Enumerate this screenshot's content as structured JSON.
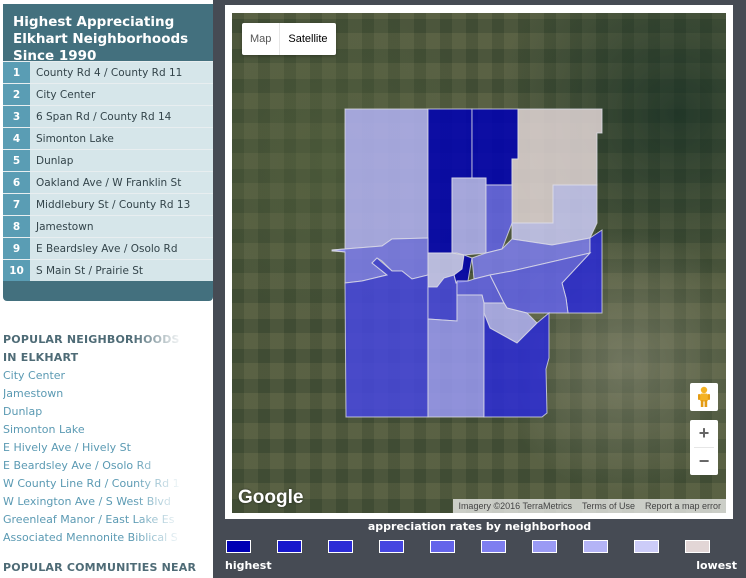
{
  "sidebar": {
    "top_list": {
      "title": "Highest Appreciating Elkhart Neighborhoods Since 1990",
      "items": [
        {
          "rank": "1",
          "name": "County Rd 4 / County Rd 11"
        },
        {
          "rank": "2",
          "name": "City Center"
        },
        {
          "rank": "3",
          "name": "6 Span Rd / County Rd 14"
        },
        {
          "rank": "4",
          "name": "Simonton Lake"
        },
        {
          "rank": "5",
          "name": "Dunlap"
        },
        {
          "rank": "6",
          "name": "Oakland Ave / W Franklin St"
        },
        {
          "rank": "7",
          "name": "Middlebury St / County Rd 13"
        },
        {
          "rank": "8",
          "name": "Jamestown"
        },
        {
          "rank": "9",
          "name": "E Beardsley Ave / Osolo Rd"
        },
        {
          "rank": "10",
          "name": "S Main St / Prairie St"
        }
      ]
    },
    "popular": {
      "heading": "POPULAR NEIGHBORHOODS IN ELKHART",
      "links": [
        "City Center",
        "Jamestown",
        "Dunlap",
        "Simonton Lake",
        "E Hively Ave / Hively St",
        "E Beardsley Ave / Osolo Rd",
        "W County Line Rd / County Rd 1",
        "W Lexington Ave / S West Blvd",
        "Greenleaf Manor / East Lake Es",
        "Associated Mennonite Biblical S"
      ]
    },
    "communities_heading": "POPULAR COMMUNITIES NEAR"
  },
  "map": {
    "map_type": {
      "map_label": "Map",
      "satellite_label": "Satellite",
      "selected": "Satellite"
    },
    "logo": "Google",
    "attribution": [
      "Imagery ©2016 TerraMetrics",
      "Terms of Use",
      "Report a map error"
    ],
    "zoom_in": "+",
    "zoom_out": "−",
    "pegman_icon": "street-view-pegman-icon"
  },
  "legend": {
    "title": "appreciation rates by neighborhood",
    "high_label": "highest",
    "low_label": "lowest",
    "colors": [
      "#0000b4",
      "#1818cc",
      "#2c2cd6",
      "#4646e0",
      "#6464ea",
      "#7e7ef0",
      "#9a9af4",
      "#b4b4f6",
      "#ccccf8",
      "#e2d6d6"
    ]
  },
  "regions": [
    {
      "name": "northwest",
      "tier": 7
    },
    {
      "name": "north-center-west",
      "tier": 0
    },
    {
      "name": "north-center-east",
      "tier": 0
    },
    {
      "name": "northeast",
      "tier": 9
    },
    {
      "name": "center-north",
      "tier": 7
    },
    {
      "name": "center-north-east",
      "tier": 4
    },
    {
      "name": "east-mid",
      "tier": 8
    },
    {
      "name": "west-mid",
      "tier": 5
    },
    {
      "name": "center-small",
      "tier": 8
    },
    {
      "name": "river-center",
      "tier": 0
    },
    {
      "name": "center-east-band",
      "tier": 5
    },
    {
      "name": "east",
      "tier": 2
    },
    {
      "name": "southwest",
      "tier": 3
    },
    {
      "name": "center-south-small",
      "tier": 3
    },
    {
      "name": "center-junction",
      "tier": 4
    },
    {
      "name": "south-center",
      "tier": 6
    },
    {
      "name": "southeast-band",
      "tier": 4
    },
    {
      "name": "south-wedge",
      "tier": 7
    },
    {
      "name": "southeast",
      "tier": 2
    }
  ]
}
